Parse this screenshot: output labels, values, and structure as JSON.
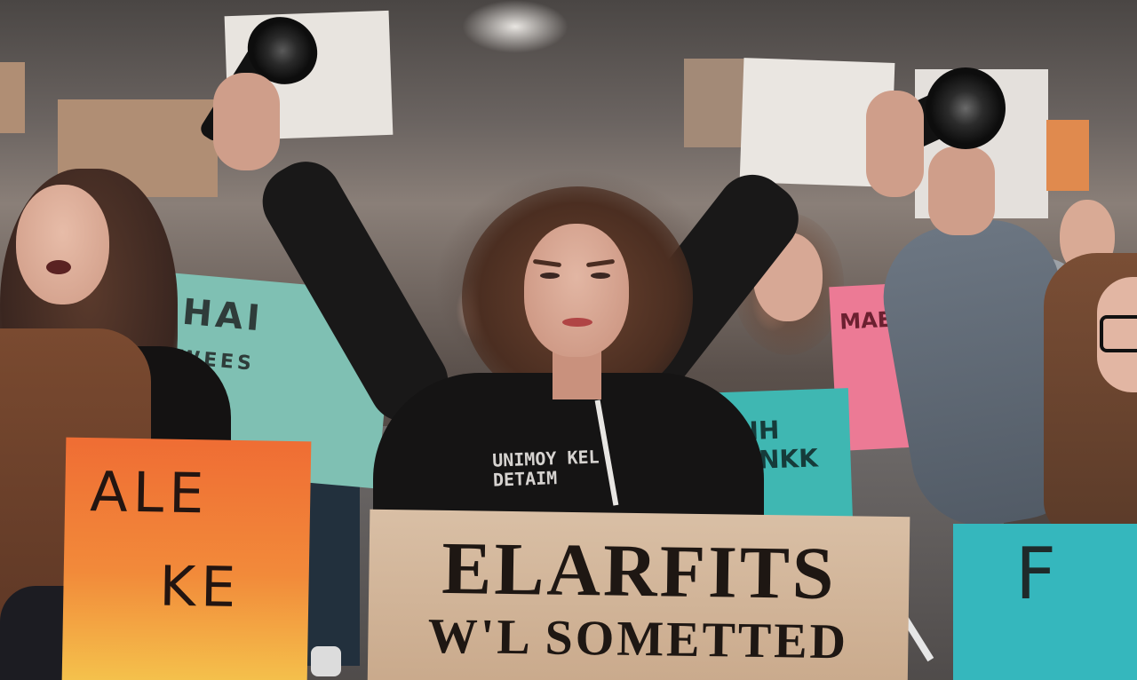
{
  "scene": {
    "description_colors": {
      "sky": "#e9e6e2",
      "hoodie": "#151414",
      "cardboard": "#d9bfa5",
      "orange_sign": "#ef6d34",
      "teal_sign": "#35b7bd",
      "pink_sign": "#ec7a95"
    }
  },
  "signs": {
    "cardboard_line1": "ELARFITS",
    "cardboard_line2": "W'L SOMETTED",
    "orange_line1": "ALE",
    "orange_line2": "KE",
    "teal_left": "HAI",
    "teal_left_small": "WEES",
    "teal_mid": "AHIH CHINKK",
    "pink": "MAE",
    "teal_right": "F"
  },
  "hoodie": {
    "print": "UNIMOY KEL DETAIM"
  }
}
